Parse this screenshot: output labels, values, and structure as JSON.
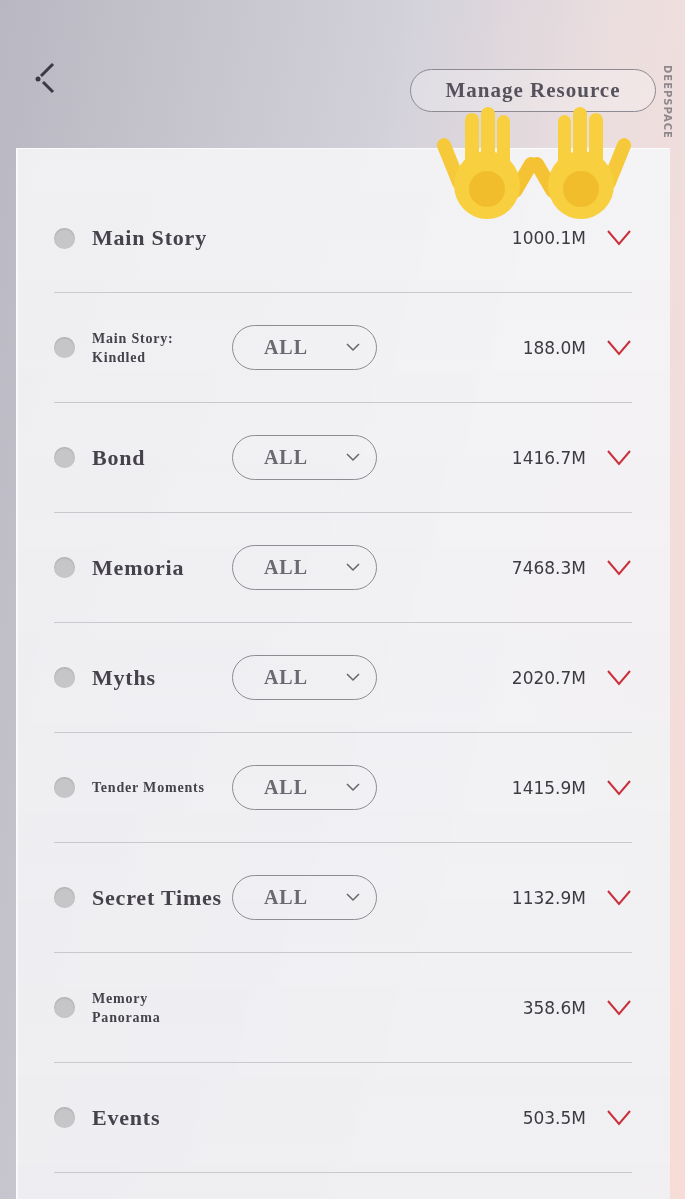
{
  "header": {
    "manage_button": "Manage Resource",
    "side_label": "DEEPSPACE"
  },
  "rows": [
    {
      "name": "Main Story",
      "compact": false,
      "size": "1000.1M",
      "checked": false,
      "expanded": false
    },
    {
      "name": "Main Story:\nKindled",
      "compact": true,
      "filter": "ALL",
      "size": "188.0M",
      "checked": false,
      "expanded": false
    },
    {
      "name": "Bond",
      "compact": false,
      "filter": "ALL",
      "size": "1416.7M",
      "checked": false,
      "expanded": false
    },
    {
      "name": "Memoria",
      "compact": false,
      "filter": "ALL",
      "size": "7468.3M",
      "checked": false,
      "expanded": false
    },
    {
      "name": "Myths",
      "compact": false,
      "filter": "ALL",
      "size": "2020.7M",
      "checked": false,
      "expanded": false
    },
    {
      "name": "Tender Moments",
      "compact": true,
      "filter": "ALL",
      "size": "1415.9M",
      "checked": false,
      "expanded": false
    },
    {
      "name": "Secret Times",
      "compact": false,
      "filter": "ALL",
      "size": "1132.9M",
      "checked": false,
      "expanded": false
    },
    {
      "name": "Memory\nPanorama",
      "compact": true,
      "size": "358.6M",
      "checked": false,
      "expanded": false
    },
    {
      "name": "Events",
      "compact": false,
      "size": "503.5M",
      "checked": false,
      "expanded": false
    }
  ]
}
